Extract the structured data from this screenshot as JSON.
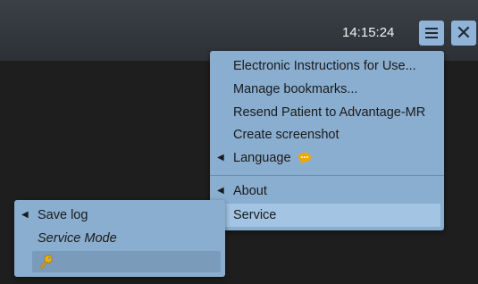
{
  "topbar": {
    "time": "14:15:24",
    "menu_icon": "hamburger-icon",
    "close_icon": "close-icon",
    "close_glyph": "✕"
  },
  "main_menu": {
    "items": [
      {
        "label": "Electronic Instructions for Use..."
      },
      {
        "label": "Manage bookmarks..."
      },
      {
        "label": "Resend Patient to Advantage-MR"
      },
      {
        "label": "Create screenshot"
      },
      {
        "label": "Language",
        "submenu": true,
        "icon": "speech-bubble-icon"
      },
      {
        "label": "About",
        "submenu": true
      },
      {
        "label": "Service",
        "highlighted": true
      }
    ]
  },
  "service_submenu": {
    "items": [
      {
        "label": "Save log",
        "submenu": true
      },
      {
        "label": "Service Mode",
        "italic": true
      },
      {
        "label": "",
        "icon": "key-icon",
        "highlighted": true
      }
    ]
  },
  "colors": {
    "menu_bg": "#8aaed0",
    "highlight": "#a3c4e2",
    "topbar": "#343a40",
    "button": "#8fb4d8",
    "speech_icon": "#f0a800"
  }
}
